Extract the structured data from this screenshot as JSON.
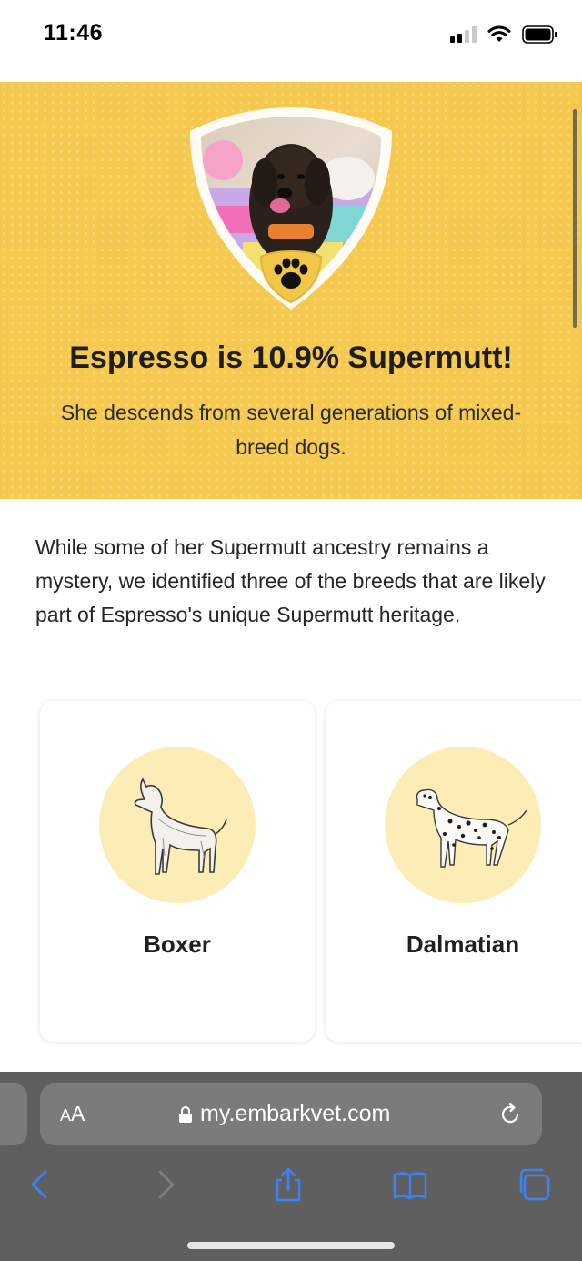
{
  "status_bar": {
    "time": "11:46"
  },
  "hero": {
    "title": "Espresso is 10.9% Supermutt!",
    "subtitle": "She descends from several generations of mixed-breed dogs."
  },
  "intro_text": "While some of her Supermutt ancestry remains a mystery, we identified three of the breeds that are likely part of Espresso's unique Supermutt heritage.",
  "breeds": [
    {
      "name": "Boxer",
      "icon": "boxer-illustration"
    },
    {
      "name": "Dalmatian",
      "icon": "dalmatian-illustration"
    }
  ],
  "browser": {
    "aa_label_big": "A",
    "aa_label_small": "A",
    "url": "my.embarkvet.com"
  },
  "colors": {
    "hero_background": "#f5c94f",
    "breed_circle": "#fcecb6",
    "browser_accent": "#3b82f6"
  }
}
